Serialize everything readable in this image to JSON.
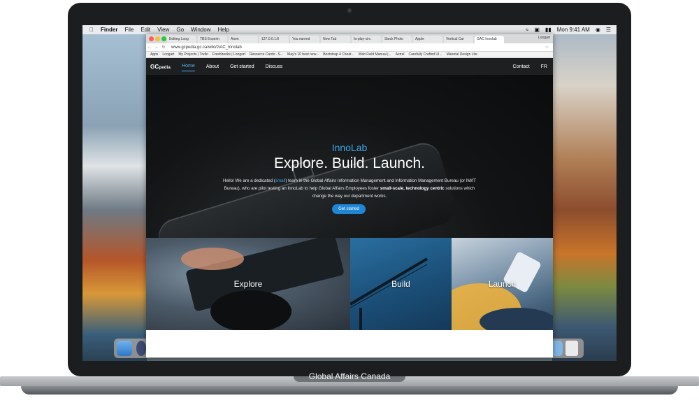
{
  "device": {
    "brand_label": "Global Affairs Canada"
  },
  "menubar": {
    "app_name": "Finder",
    "items": [
      "File",
      "Edit",
      "View",
      "Go",
      "Window",
      "Help"
    ],
    "clock": "Mon 9:41 AM"
  },
  "browser": {
    "tabs": [
      {
        "label": "Editing Loog"
      },
      {
        "label": "TBS Experin"
      },
      {
        "label": "Atom"
      },
      {
        "label": "127.0.0.1:8"
      },
      {
        "label": "You earned"
      },
      {
        "label": "New Tab"
      },
      {
        "label": "fa-play-circ"
      },
      {
        "label": "Stock Photo"
      },
      {
        "label": "Apple"
      },
      {
        "label": "Vertical Car"
      },
      {
        "label": "GAC Innolab",
        "active": true
      }
    ],
    "profile": "Loogart",
    "url": "www.gcpedia.gc.ca/wiki/GAC_Innolab",
    "bookmarks": [
      "Apps",
      "Loogart",
      "My Projects | Trello",
      "Freshbooks | Loogart",
      "Resource Cards - S...",
      "May's 10 best new...",
      "Bootstrap 4 Cheat...",
      "Web Field Manual |...",
      "Astral",
      "Carefully Crafted UI...",
      "Material Design Lite"
    ]
  },
  "site": {
    "logo": "GC",
    "logo_sub": "pedia",
    "nav": [
      {
        "label": "Home",
        "active": true
      },
      {
        "label": "About"
      },
      {
        "label": "Get started"
      },
      {
        "label": "Discuss"
      }
    ],
    "nav_right": [
      "Contact",
      "FR"
    ],
    "hero": {
      "eyebrow": "InnoLab",
      "title": "Explore. Build. Launch.",
      "desc_1": "Hello! We are a dedicated (",
      "desc_hl": "small",
      "desc_2": ") team in the Global Affairs Information Management and Information Management Bureau (or IM/IT Bureau), who are pilot testing an InnoLab to help Global Affairs Employees foster ",
      "desc_bold": "small-scale, technology centric",
      "desc_3": " solutions which change the way our department works.",
      "cta": "Get started"
    },
    "cards": [
      {
        "label": "Explore"
      },
      {
        "label": "Build"
      },
      {
        "label": "Launch"
      }
    ]
  }
}
